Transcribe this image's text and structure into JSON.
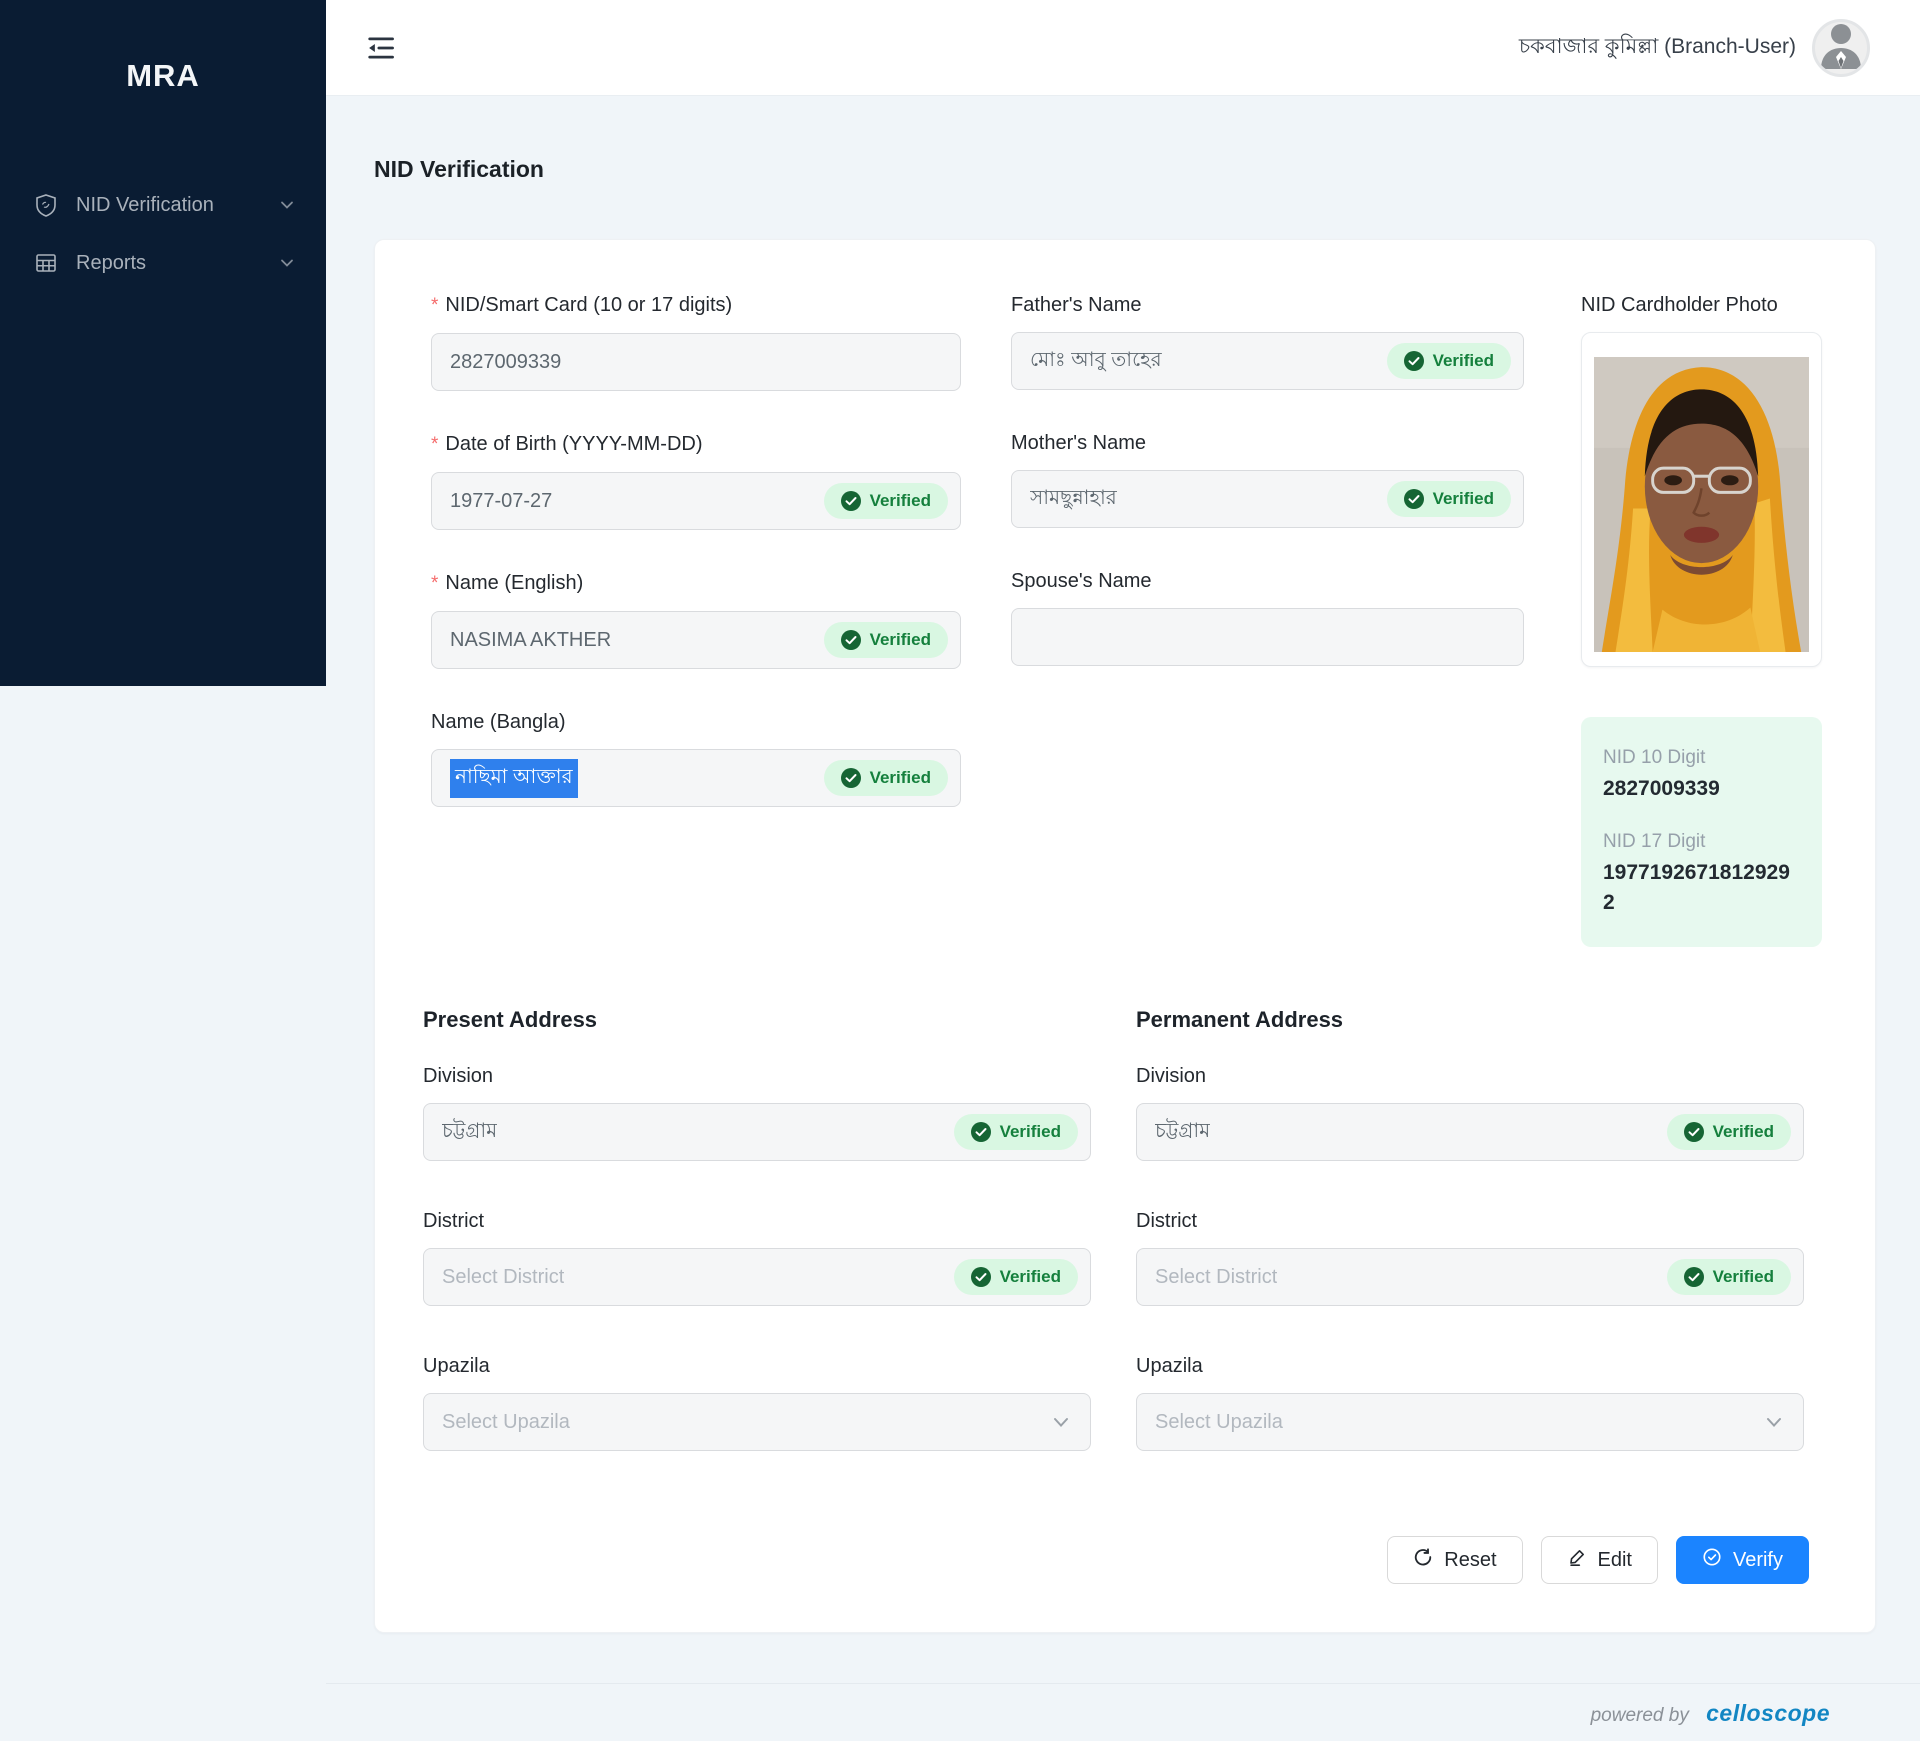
{
  "brand": "MRA",
  "sidebar": {
    "items": [
      {
        "label": "NID Verification",
        "icon": "shield-icon"
      },
      {
        "label": "Reports",
        "icon": "table-icon"
      }
    ]
  },
  "header": {
    "user_name": "চকবাজার কুমিল্লা (Branch-User)",
    "avatar_icon": "person-icon",
    "collapse_icon": "menu-fold-icon"
  },
  "page_title": "NID Verification",
  "ui": {
    "required_marker": "*",
    "verified_label": "Verified"
  },
  "form": {
    "fields": {
      "nid": {
        "label": "NID/Smart Card (10 or 17 digits)",
        "required": true,
        "value": "2827009339",
        "verified": false
      },
      "dob": {
        "label": "Date of Birth (YYYY-MM-DD)",
        "required": true,
        "value": "1977-07-27",
        "verified": true
      },
      "name_en": {
        "label": "Name (English)",
        "required": true,
        "value": "NASIMA AKTHER",
        "verified": true
      },
      "name_bn": {
        "label": "Name (Bangla)",
        "required": false,
        "value": "নাছিমা আক্তার",
        "verified": true,
        "selected": true
      },
      "father": {
        "label": "Father's Name",
        "required": false,
        "value": "মোঃ আবু তাহের",
        "verified": true
      },
      "mother": {
        "label": "Mother's Name",
        "required": false,
        "value": "সামছুন্নাহার",
        "verified": true
      },
      "spouse": {
        "label": "Spouse's Name",
        "required": false,
        "value": "",
        "verified": false
      }
    },
    "photo": {
      "label": "NID Cardholder Photo"
    },
    "nid_summary": {
      "nid10_label": "NID 10 Digit",
      "nid10_value": "2827009339",
      "nid17_label": "NID 17 Digit",
      "nid17_value": "19771926718129292"
    },
    "present": {
      "heading": "Present Address",
      "division": {
        "label": "Division",
        "value": "চট্টগ্রাম",
        "verified": true
      },
      "district": {
        "label": "District",
        "placeholder": "Select District",
        "verified": true
      },
      "upazila": {
        "label": "Upazila",
        "placeholder": "Select Upazila"
      }
    },
    "permanent": {
      "heading": "Permanent Address",
      "division": {
        "label": "Division",
        "value": "চট্টগ্রাম",
        "verified": true
      },
      "district": {
        "label": "District",
        "placeholder": "Select District",
        "verified": true
      },
      "upazila": {
        "label": "Upazila",
        "placeholder": "Select Upazila"
      }
    },
    "actions": {
      "reset": {
        "label": "Reset",
        "icon": "reload-icon"
      },
      "edit": {
        "label": "Edit",
        "icon": "pencil-icon"
      },
      "verify": {
        "label": "Verify",
        "icon": "check-circle-icon"
      }
    }
  },
  "footer": {
    "powered_by": "powered by",
    "brand": "celloscope"
  },
  "colors": {
    "sidebar_bg": "#0a1c33",
    "page_bg": "#f0f5f9",
    "accent_blue": "#1b84ff",
    "verified_bg": "#d9f7e2",
    "verified_text": "#15803d",
    "selection_blue": "#2f80ed",
    "celloscope_blue": "#1286c3"
  }
}
